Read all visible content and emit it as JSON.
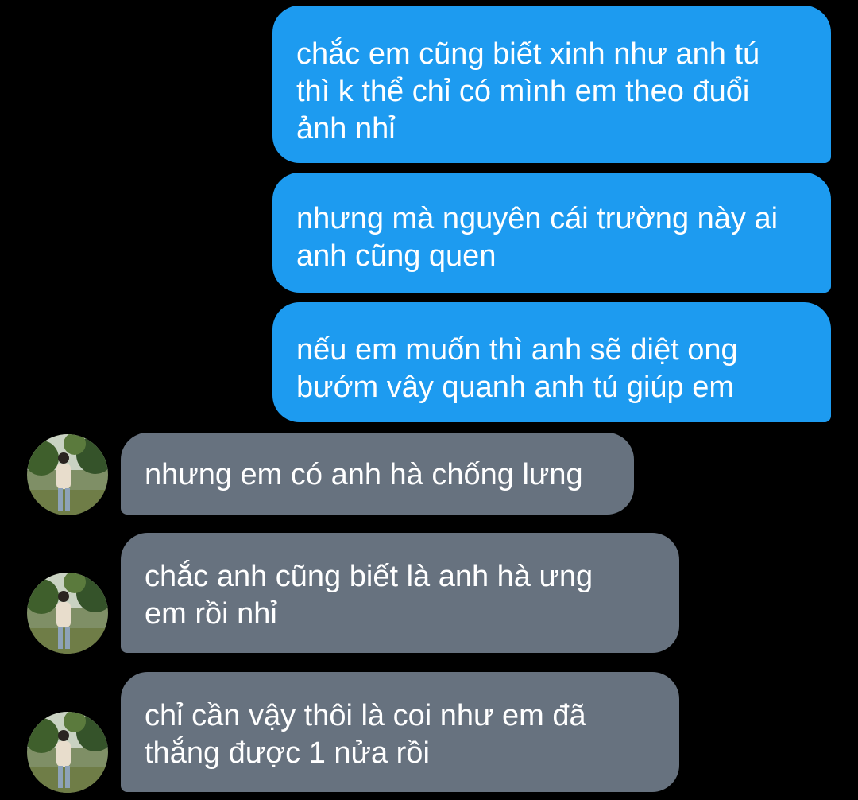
{
  "messages": [
    {
      "side": "sent",
      "text": "chắc em cũng biết xinh như anh tú\nthì k thể chỉ có mình em theo đuổi\nảnh nhỉ"
    },
    {
      "side": "sent",
      "text": "nhưng mà nguyên cái trường này ai\nanh cũng quen"
    },
    {
      "side": "sent",
      "text": "nếu em muốn thì anh sẽ diệt ong\nbướm vây quanh anh tú giúp em"
    },
    {
      "side": "received",
      "text": "nhưng em có anh hà chống lưng"
    },
    {
      "side": "received",
      "text": "chắc anh cũng biết là anh hà ưng\nem rồi nhỉ"
    },
    {
      "side": "received",
      "text": "chỉ cần vậy thôi là coi như em đã\nthắng được 1 nửa rồi"
    }
  ],
  "colors": {
    "background": "#000000",
    "sent_bubble": "#1d9bf0",
    "received_bubble": "#67727f",
    "text": "#ffffff"
  },
  "avatar": {
    "icon": "contact-photo-avatar"
  }
}
